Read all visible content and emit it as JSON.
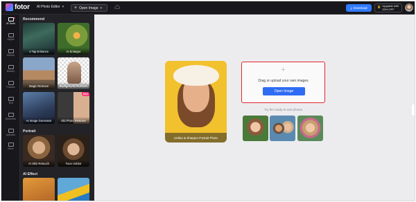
{
  "topbar": {
    "logo_text": "fotor",
    "editor_select": "AI Photo Editor",
    "open_image": "Open Image",
    "download": "Download",
    "upgrade_line1": "Upgrade with",
    "upgrade_line2": "20% OFF"
  },
  "rail": {
    "items": [
      {
        "label": "AI Tools",
        "icon": "ai-tools-icon"
      },
      {
        "label": "Adjust",
        "icon": "adjust-icon"
      },
      {
        "label": "Effects",
        "icon": "effects-icon"
      },
      {
        "label": "Beauty",
        "icon": "beauty-icon"
      },
      {
        "label": "Frames",
        "icon": "frames-icon"
      },
      {
        "label": "Text",
        "icon": "text-icon"
      },
      {
        "label": "Elements",
        "icon": "elements-icon"
      },
      {
        "label": "Uploads",
        "icon": "uploads-icon"
      },
      {
        "label": "More",
        "icon": "more-icon"
      }
    ]
  },
  "panel": {
    "recommend_title": "Recommend",
    "portrait_title": "Portrait",
    "ai_effect_title": "AI Effect",
    "new_badge": "New",
    "tools": [
      {
        "label": "1-Tap Enhance"
      },
      {
        "label": "AI Enlarger"
      },
      {
        "label": "Magic Remove"
      },
      {
        "label": "Background Remover"
      },
      {
        "label": "AI Image Generator"
      },
      {
        "label": "Old Photo Restorer"
      },
      {
        "label": "AI Skin Retouch"
      },
      {
        "label": "Face Unblur"
      }
    ]
  },
  "main": {
    "preview_label": "Unblur & Sharpen Portrait Photo",
    "upload_text": "Drag or upload your own images",
    "open_button": "Open Image",
    "try_text": "Try the ready-to-use photos"
  },
  "colors": {
    "accent_blue": "#2f6cf3",
    "highlight_red": "#e0242c",
    "dark_bg": "#1f1f24"
  }
}
